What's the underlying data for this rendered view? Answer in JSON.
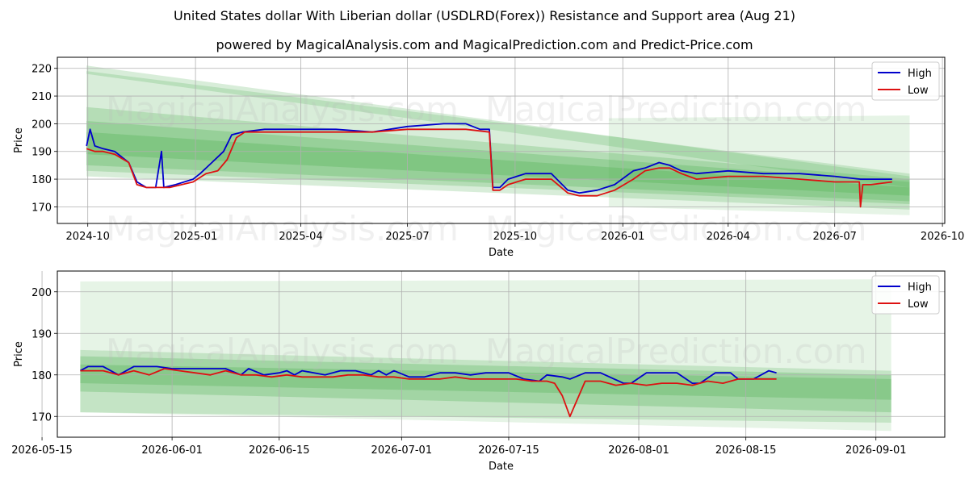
{
  "title": "United States dollar With Liberian dollar (USDLRD(Forex)) Resistance and Support area (Aug 21)",
  "subtitle": "powered by MagicalAnalysis.com and MagicalPrediction.com and Predict-Price.com",
  "watermarks": [
    "MagicalAnalysis.com",
    "MagicalPrediction.com"
  ],
  "colors": {
    "high": "#0000cc",
    "low": "#dd1111",
    "band": "#4caf50",
    "grid": "#b0b0b0"
  },
  "chart_data": [
    {
      "type": "line",
      "xlabel": "Date",
      "ylabel": "Price",
      "xlim": [
        "2024-09-05",
        "2026-10-03"
      ],
      "ylim": [
        164,
        224
      ],
      "x_ticks": [
        "2024-10",
        "2025-01",
        "2025-04",
        "2025-07",
        "2025-10",
        "2026-01",
        "2026-04",
        "2026-07",
        "2026-10"
      ],
      "y_ticks": [
        170,
        180,
        190,
        200,
        210,
        220
      ],
      "grid": true,
      "legend": "top-right",
      "legend_entries": [
        "High",
        "Low"
      ],
      "bands": [
        {
          "start": "2024-09-30",
          "end": "2026-09-03",
          "upper": [
            221,
            181
          ],
          "lower": [
            218,
            177
          ],
          "alpha": 0.22
        },
        {
          "start": "2024-09-30",
          "end": "2026-09-03",
          "upper": [
            219,
            182
          ],
          "lower": [
            181,
            169
          ],
          "alpha": 0.22
        },
        {
          "start": "2024-09-30",
          "end": "2026-09-03",
          "upper": [
            206,
            180
          ],
          "lower": [
            183,
            171
          ],
          "alpha": 0.25
        },
        {
          "start": "2024-09-30",
          "end": "2026-09-03",
          "upper": [
            201,
            179
          ],
          "lower": [
            185,
            172
          ],
          "alpha": 0.28
        },
        {
          "start": "2024-09-30",
          "end": "2026-09-03",
          "upper": [
            197,
            177
          ],
          "lower": [
            189,
            174
          ],
          "alpha": 0.3
        },
        {
          "start": "2025-12-20",
          "end": "2026-09-03",
          "upper": [
            202,
            203
          ],
          "lower": [
            170,
            167
          ],
          "alpha": 0.14
        }
      ],
      "series": [
        {
          "name": "High",
          "x": [
            "2024-09-30",
            "2024-10-03",
            "2024-10-07",
            "2024-10-14",
            "2024-10-24",
            "2024-11-05",
            "2024-11-12",
            "2024-11-20",
            "2024-11-28",
            "2024-12-03",
            "2024-12-05",
            "2024-12-15",
            "2024-12-30",
            "2025-01-05",
            "2025-01-15",
            "2025-01-25",
            "2025-02-01",
            "2025-02-10",
            "2025-03-01",
            "2025-04-01",
            "2025-05-01",
            "2025-06-01",
            "2025-07-01",
            "2025-08-01",
            "2025-08-20",
            "2025-09-01",
            "2025-09-09",
            "2025-09-12",
            "2025-09-18",
            "2025-09-25",
            "2025-10-10",
            "2025-11-01",
            "2025-11-15",
            "2025-11-25",
            "2025-12-10",
            "2025-12-25",
            "2026-01-10",
            "2026-01-20",
            "2026-02-01",
            "2026-02-10",
            "2026-02-20",
            "2026-03-05",
            "2026-04-01",
            "2026-05-01",
            "2026-06-01",
            "2026-07-01",
            "2026-07-23",
            "2026-08-01",
            "2026-08-19"
          ],
          "values": [
            192,
            198,
            192,
            191,
            190,
            186,
            179,
            177,
            177,
            190,
            177,
            178,
            180,
            182,
            186,
            190,
            196,
            197,
            198,
            198,
            198,
            197,
            199,
            200,
            200,
            198,
            198,
            177,
            177,
            180,
            182,
            182,
            176,
            175,
            176,
            178,
            183,
            184,
            186,
            185,
            183,
            182,
            183,
            182,
            182,
            181,
            180,
            180,
            180
          ]
        },
        {
          "name": "Low",
          "x": [
            "2024-09-30",
            "2024-10-07",
            "2024-10-14",
            "2024-10-24",
            "2024-11-05",
            "2024-11-12",
            "2024-11-20",
            "2024-11-28",
            "2024-12-10",
            "2024-12-30",
            "2025-01-10",
            "2025-01-20",
            "2025-01-28",
            "2025-02-05",
            "2025-02-12",
            "2025-03-01",
            "2025-04-01",
            "2025-05-01",
            "2025-06-01",
            "2025-07-01",
            "2025-08-01",
            "2025-08-20",
            "2025-09-09",
            "2025-09-12",
            "2025-09-18",
            "2025-09-25",
            "2025-10-10",
            "2025-11-01",
            "2025-11-15",
            "2025-11-25",
            "2025-12-10",
            "2025-12-25",
            "2026-01-10",
            "2026-01-20",
            "2026-02-01",
            "2026-02-10",
            "2026-02-20",
            "2026-03-05",
            "2026-04-01",
            "2026-05-01",
            "2026-06-01",
            "2026-07-01",
            "2026-07-22",
            "2026-07-23",
            "2026-07-25",
            "2026-08-01",
            "2026-08-19"
          ],
          "values": [
            191,
            190,
            190,
            189,
            186,
            178,
            177,
            177,
            177,
            179,
            182,
            183,
            187,
            195,
            197,
            197,
            197,
            197,
            197,
            198,
            198,
            198,
            197,
            176,
            176,
            178,
            180,
            180,
            175,
            174,
            174,
            176,
            180,
            183,
            184,
            184,
            182,
            180,
            181,
            181,
            180,
            179,
            179,
            170,
            178,
            178,
            179
          ]
        }
      ]
    },
    {
      "type": "line",
      "xlabel": "Date",
      "ylabel": "Price",
      "xlim": [
        "2026-05-17",
        "2026-09-10"
      ],
      "ylim": [
        165,
        205
      ],
      "x_ticks": [
        "2026-05-15",
        "2026-06-01",
        "2026-06-15",
        "2026-07-01",
        "2026-07-15",
        "2026-08-01",
        "2026-08-15",
        "2026-09-01"
      ],
      "y_ticks": [
        170,
        180,
        190,
        200
      ],
      "grid": true,
      "legend": "top-right",
      "legend_entries": [
        "High",
        "Low"
      ],
      "bands": [
        {
          "start": "2026-05-20",
          "end": "2026-09-03",
          "upper": [
            202.5,
            203
          ],
          "lower": [
            171,
            166.5
          ],
          "alpha": 0.14
        },
        {
          "start": "2026-05-20",
          "end": "2026-09-03",
          "upper": [
            186,
            181
          ],
          "lower": [
            171,
            168.5
          ],
          "alpha": 0.22
        },
        {
          "start": "2026-05-20",
          "end": "2026-09-03",
          "upper": [
            184.5,
            180
          ],
          "lower": [
            176,
            171
          ],
          "alpha": 0.28
        },
        {
          "start": "2026-05-20",
          "end": "2026-09-03",
          "upper": [
            182.5,
            179
          ],
          "lower": [
            178,
            174
          ],
          "alpha": 0.3
        }
      ],
      "series": [
        {
          "name": "High",
          "x": [
            "2026-05-20",
            "2026-05-21",
            "2026-05-23",
            "2026-05-25",
            "2026-05-27",
            "2026-05-28",
            "2026-05-30",
            "2026-06-01",
            "2026-06-04",
            "2026-06-06",
            "2026-06-08",
            "2026-06-10",
            "2026-06-11",
            "2026-06-13",
            "2026-06-15",
            "2026-06-16",
            "2026-06-17",
            "2026-06-18",
            "2026-06-21",
            "2026-06-23",
            "2026-06-25",
            "2026-06-27",
            "2026-06-28",
            "2026-06-29",
            "2026-06-30",
            "2026-07-02",
            "2026-07-04",
            "2026-07-06",
            "2026-07-08",
            "2026-07-10",
            "2026-07-12",
            "2026-07-15",
            "2026-07-17",
            "2026-07-19",
            "2026-07-20",
            "2026-07-22",
            "2026-07-23",
            "2026-07-25",
            "2026-07-27",
            "2026-07-30",
            "2026-07-31",
            "2026-08-02",
            "2026-08-04",
            "2026-08-06",
            "2026-08-08",
            "2026-08-09",
            "2026-08-11",
            "2026-08-13",
            "2026-08-14",
            "2026-08-16",
            "2026-08-18",
            "2026-08-19"
          ],
          "values": [
            181,
            182,
            182,
            180,
            182,
            182,
            182,
            181.5,
            181.5,
            181.5,
            181.5,
            180,
            181.5,
            180,
            180.5,
            181,
            180,
            181,
            180,
            181,
            181,
            180,
            181,
            180,
            181,
            179.5,
            179.5,
            180.5,
            180.5,
            180,
            180.5,
            180.5,
            179,
            178.5,
            180,
            179.5,
            179,
            180.5,
            180.5,
            178,
            178,
            180.5,
            180.5,
            180.5,
            178,
            178,
            180.5,
            180.5,
            179,
            179,
            181,
            180.5
          ]
        },
        {
          "name": "Low",
          "x": [
            "2026-05-20",
            "2026-05-23",
            "2026-05-25",
            "2026-05-27",
            "2026-05-29",
            "2026-05-31",
            "2026-06-02",
            "2026-06-04",
            "2026-06-06",
            "2026-06-08",
            "2026-06-10",
            "2026-06-12",
            "2026-06-14",
            "2026-06-16",
            "2026-06-18",
            "2026-06-20",
            "2026-06-22",
            "2026-06-24",
            "2026-06-26",
            "2026-06-28",
            "2026-06-30",
            "2026-07-02",
            "2026-07-04",
            "2026-07-06",
            "2026-07-08",
            "2026-07-10",
            "2026-07-12",
            "2026-07-14",
            "2026-07-16",
            "2026-07-18",
            "2026-07-20",
            "2026-07-21",
            "2026-07-22",
            "2026-07-23",
            "2026-07-25",
            "2026-07-27",
            "2026-07-29",
            "2026-07-31",
            "2026-08-02",
            "2026-08-04",
            "2026-08-06",
            "2026-08-08",
            "2026-08-10",
            "2026-08-12",
            "2026-08-14",
            "2026-08-16",
            "2026-08-19"
          ],
          "values": [
            181,
            181,
            180,
            181,
            180,
            181.5,
            181,
            180.5,
            180,
            181,
            180,
            180,
            179.5,
            180,
            179.5,
            179.5,
            179.5,
            180,
            180,
            179.5,
            179.5,
            179,
            179,
            179,
            179.5,
            179,
            179,
            179,
            179,
            178.5,
            178.5,
            178,
            175,
            170,
            178.5,
            178.5,
            177.5,
            178,
            177.5,
            178,
            178,
            177.5,
            178.5,
            178,
            179,
            179,
            179
          ]
        }
      ]
    }
  ]
}
